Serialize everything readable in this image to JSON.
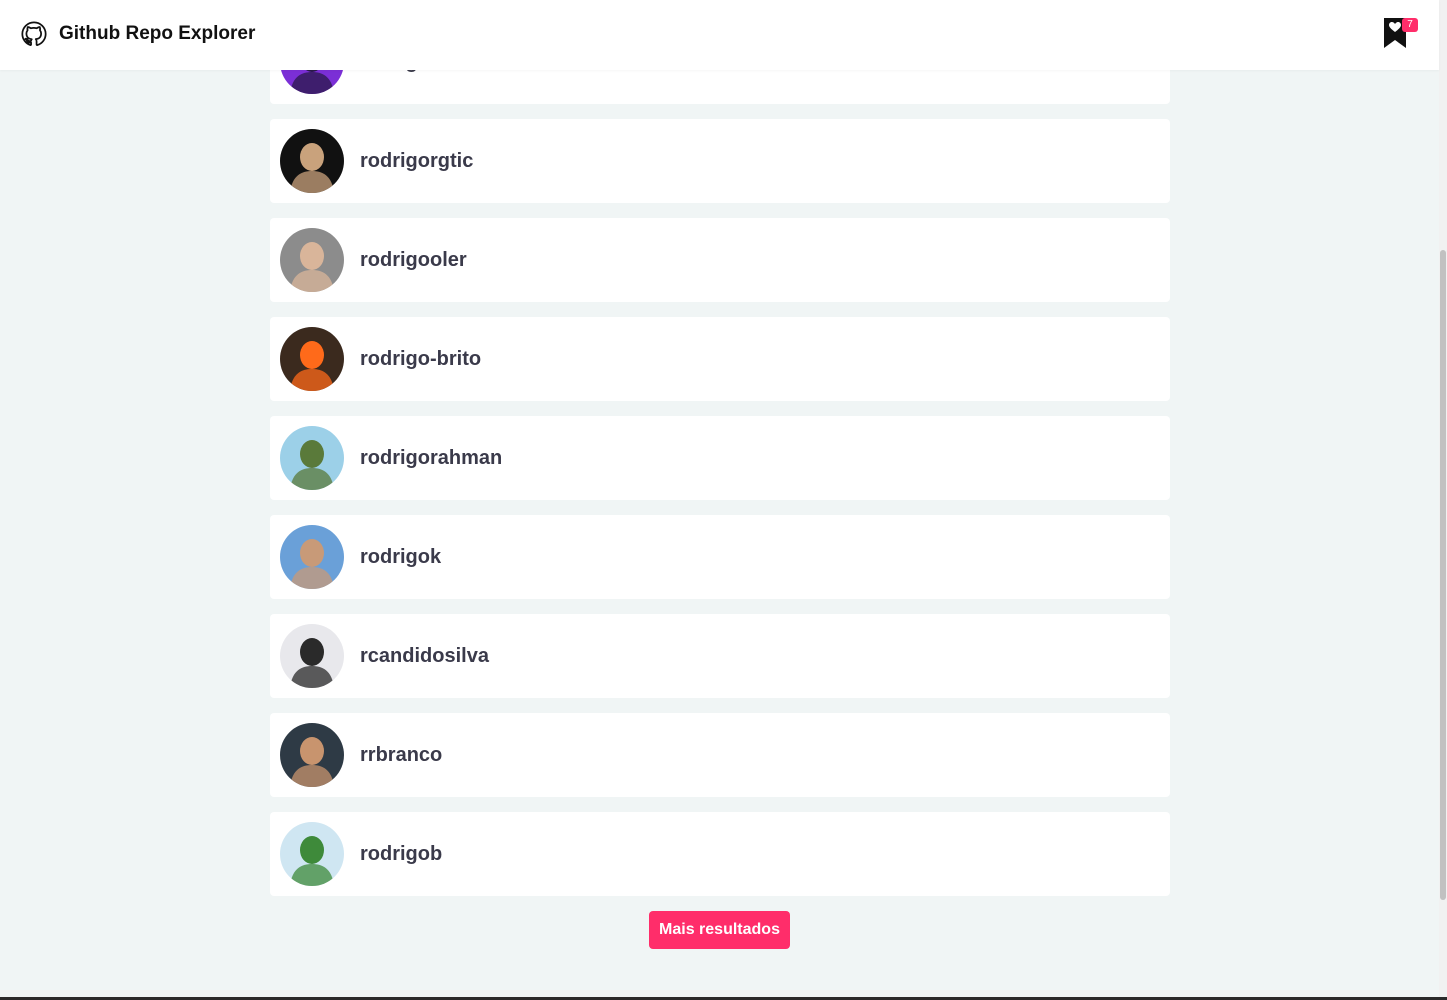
{
  "header": {
    "title": "Github Repo Explorer",
    "logo_icon": "github-icon",
    "favorites_icon": "bookmark-heart-icon",
    "favorites_count": "7",
    "badge_color": "#ff2d6a"
  },
  "users": [
    {
      "login": "rodrigo",
      "avatar_colors": [
        "#7b2fd6",
        "#2a1a4a"
      ]
    },
    {
      "login": "rodrigorgtic",
      "avatar_colors": [
        "#111111",
        "#c9a27c"
      ]
    },
    {
      "login": "rodrigooler",
      "avatar_colors": [
        "#8c8c8c",
        "#d9b59a"
      ]
    },
    {
      "login": "rodrigo-brito",
      "avatar_colors": [
        "#3b2a1e",
        "#ff6a1a"
      ]
    },
    {
      "login": "rodrigorahman",
      "avatar_colors": [
        "#9cd0e8",
        "#5a7a3a"
      ]
    },
    {
      "login": "rodrigok",
      "avatar_colors": [
        "#6aa0d8",
        "#c89a78"
      ]
    },
    {
      "login": "rcandidosilva",
      "avatar_colors": [
        "#e8e8ec",
        "#2a2a2a"
      ]
    },
    {
      "login": "rrbranco",
      "avatar_colors": [
        "#2e3a45",
        "#c8946e"
      ]
    },
    {
      "login": "rodrigob",
      "avatar_colors": [
        "#cfe6f2",
        "#3e8a3a"
      ]
    }
  ],
  "load_more_label": "Mais resultados",
  "accent_color": "#ff2d6a"
}
